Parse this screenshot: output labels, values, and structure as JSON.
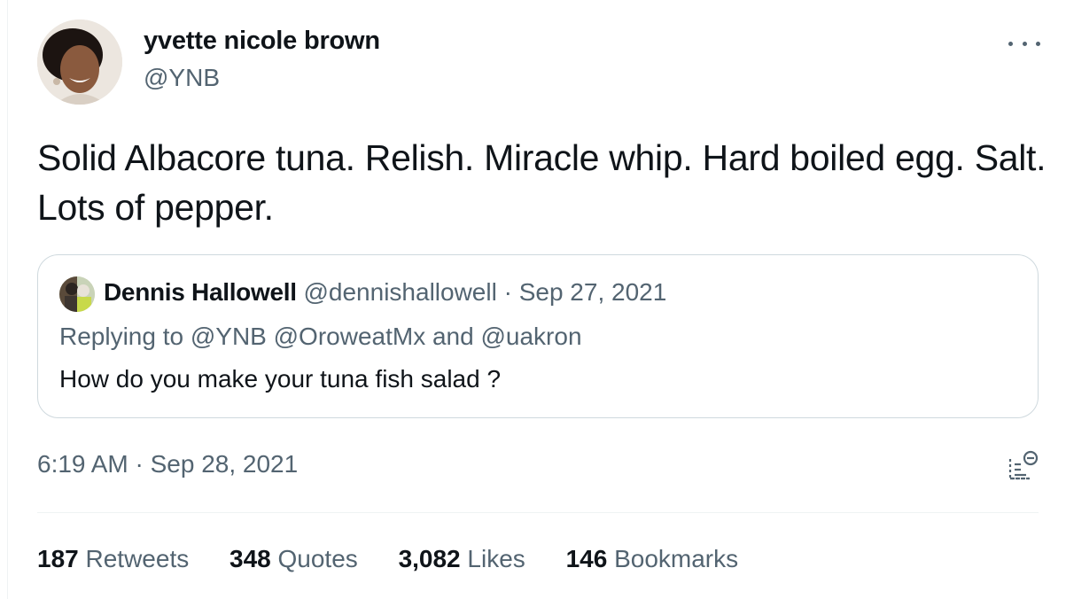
{
  "tweet": {
    "author_name": "yvette nicole brown",
    "author_handle": "@YNB",
    "text": "Solid Albacore tuna. Relish. Miracle whip. Hard boiled egg. Salt. Lots of pepper.",
    "timestamp": "6:19 AM · Sep 28, 2021"
  },
  "quoted": {
    "author_name": "Dennis Hallowell",
    "author_handle": "@dennishallowell",
    "separator": " · ",
    "date": "Sep 27, 2021",
    "replying_to": "Replying to @YNB @OroweatMx and @uakron",
    "text": "How do you make your tuna fish salad ?"
  },
  "stats": [
    {
      "value": "187",
      "label": "Retweets"
    },
    {
      "value": "348",
      "label": "Quotes"
    },
    {
      "value": "3,082",
      "label": "Likes"
    },
    {
      "value": "146",
      "label": "Bookmarks"
    }
  ],
  "icons": {
    "more": "more-horizontal-icon",
    "analytics": "analytics-icon"
  },
  "colors": {
    "text": "#0f1419",
    "secondary": "#536471",
    "border": "#cfd9de"
  }
}
